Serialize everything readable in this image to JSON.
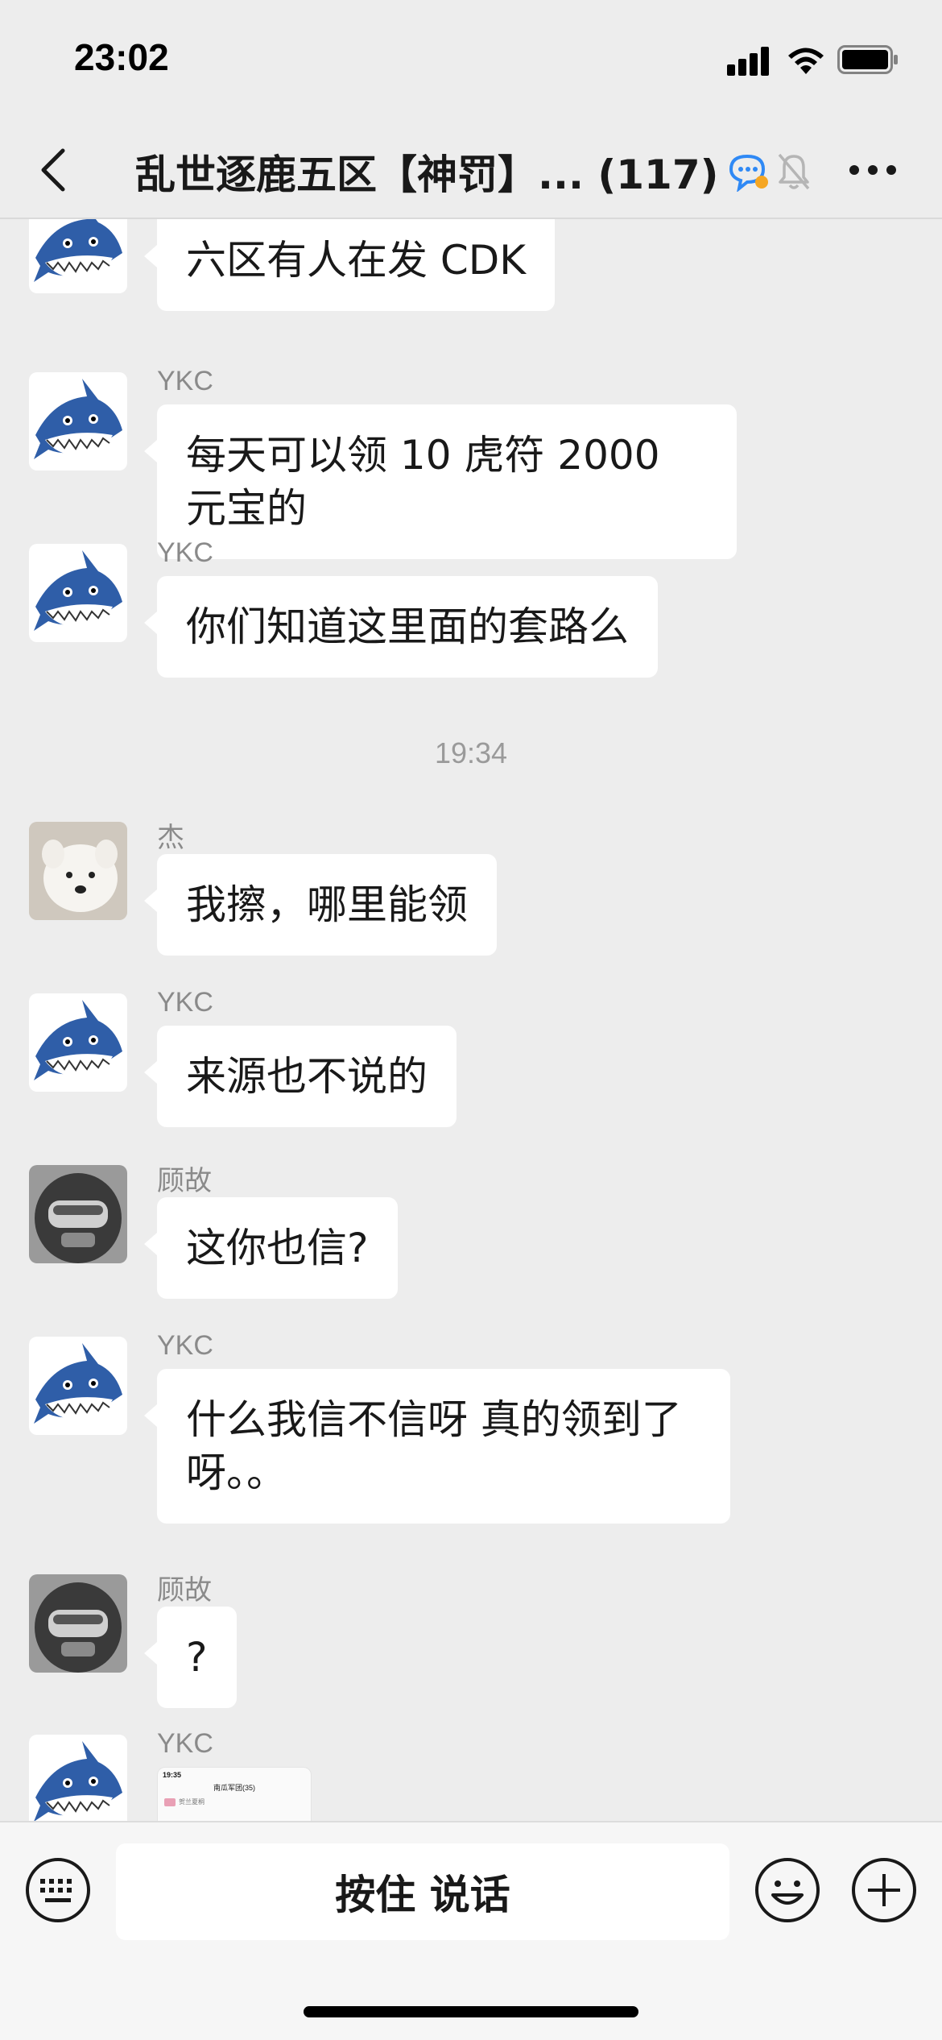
{
  "status_bar": {
    "time": "23:02"
  },
  "nav": {
    "title": "乱世逐鹿五区【神罚】... (117)",
    "icons": [
      "back-icon",
      "chat-bubble-icon",
      "mute-icon",
      "more-icon"
    ]
  },
  "messages": [
    {
      "sender": "",
      "avatar": "shark",
      "text": "六区有人在发 CDK"
    },
    {
      "sender": "YKC",
      "avatar": "shark",
      "text": "每天可以领 10 虎符 2000 元宝的"
    },
    {
      "sender": "YKC",
      "avatar": "shark",
      "text": "你们知道这里面的套路么"
    },
    {
      "timestamp": "19:34"
    },
    {
      "sender": "杰",
      "avatar": "dog",
      "text": "我擦，哪里能领"
    },
    {
      "sender": "YKC",
      "avatar": "shark",
      "text": "来源也不说的"
    },
    {
      "sender": "顾故",
      "avatar": "helmet",
      "text": "这你也信?"
    },
    {
      "sender": "YKC",
      "avatar": "shark",
      "text": "什么我信不信呀 真的领到了呀。。"
    },
    {
      "sender": "顾故",
      "avatar": "helmet",
      "text": "?"
    },
    {
      "sender": "YKC",
      "avatar": "shark",
      "type": "image",
      "thumb_time": "19:35",
      "thumb_title": "南瓜军团(35)",
      "thumb_line": "贺兰夏桐"
    }
  ],
  "input_bar": {
    "hold_to_talk_label": "按住 说话",
    "icons": [
      "keyboard-icon",
      "emoji-icon",
      "plus-icon"
    ]
  },
  "colors": {
    "background": "#ededed",
    "bubble": "#ffffff",
    "text": "#191919",
    "meta": "#8a8a8a"
  }
}
